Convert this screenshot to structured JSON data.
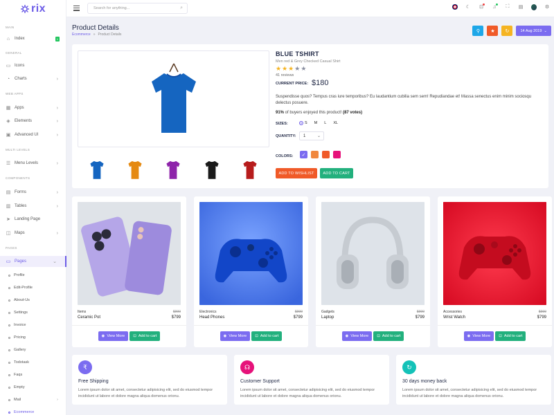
{
  "brand": {
    "name": "rix"
  },
  "sidebar": {
    "sections": [
      "Main",
      "General",
      "Web Apps",
      "Multi Levels",
      "Components",
      "Pages"
    ],
    "items": [
      {
        "label": "Index",
        "badge": "1"
      },
      {
        "label": "Icons"
      },
      {
        "label": "Charts"
      },
      {
        "label": "Apps"
      },
      {
        "label": "Elements"
      },
      {
        "label": "Advanced UI"
      },
      {
        "label": "Menu Levels"
      },
      {
        "label": "Forms"
      },
      {
        "label": "Tables"
      },
      {
        "label": "Landing Page"
      },
      {
        "label": "Maps"
      },
      {
        "label": "Pages"
      }
    ],
    "sub_items": [
      "Profile",
      "Edit-Profile",
      "About-Us",
      "Settings",
      "Invoice",
      "Pricing",
      "Gallery",
      "Todotask",
      "Faqs",
      "Empty",
      "Mail",
      "Ecommerce"
    ]
  },
  "topbar": {
    "search_placeholder": "Search for anything..."
  },
  "page": {
    "title": "Product Details",
    "breadcrumb": [
      "Ecommerce",
      "Product Details"
    ],
    "date": "14 Aug 2019"
  },
  "product": {
    "name": "BLUE TSHIRT",
    "subtitle": "Men red & Grey Checked Casual Shirt",
    "rating": 3,
    "rating_max": 5,
    "reviews": "41 reviews",
    "price_label": "CURRENT PRICE:",
    "price": "$180",
    "description": "Suspendisse quos? Tempus cras iure temporibus? Eu laudantium cubilia sem sem! Repudiandae et! Massa senectus enim minim sociosqu delectus posuere.",
    "enjoyed_pct": "91%",
    "enjoyed_text": " of buyers enjoyed this product! ",
    "enjoyed_votes": "(87 votes)",
    "sizes_label": "SIZES:",
    "sizes": [
      "S",
      "M",
      "L",
      "XL"
    ],
    "quantity_label": "QUANTITY:",
    "quantity": "1",
    "colors_label": "COLORS:",
    "colors": [
      "#7b6cf0",
      "#f0883e",
      "#f05a28",
      "#e6127a"
    ],
    "wishlist_label": "ADD TO WISHLIST",
    "cart_label": "ADD TO CART",
    "thumb_colors": [
      "#1565c0",
      "#e58a12",
      "#8e24aa",
      "#1a1a1a",
      "#b71c1c"
    ],
    "main_color": "#1565c0"
  },
  "products": [
    {
      "category": "Items",
      "name": "Ceramic Pot",
      "old_price": "$999",
      "price": "$799",
      "view": "View More",
      "cart": "Add to cart"
    },
    {
      "category": "Electronics",
      "name": "Head Phones",
      "old_price": "$999",
      "price": "$799",
      "view": "View More",
      "cart": "Add to cart"
    },
    {
      "category": "Gadgets",
      "name": "Laptop",
      "old_price": "$999",
      "price": "$799",
      "view": "View More",
      "cart": "Add to cart"
    },
    {
      "category": "Accessories",
      "name": "Wrist Watch",
      "old_price": "$999",
      "price": "$799",
      "view": "View More",
      "cart": "Add to cart"
    }
  ],
  "features": [
    {
      "title": "Free Shipping",
      "text": "Lorem ipsum dolor sit amet, consectetur adipisicing elit, sed do eiusmod tempor incididunt ut labore et dolore magna aliqua domenus orionu.",
      "color": "#7b6cf0",
      "icon": "currency-icon"
    },
    {
      "title": "Customer Support",
      "text": "Lorem ipsum dolor sit amet, consectetur adipisicing elit, sed do eiusmod tempor incididunt ut labore et dolore magna aliqua domenus orionu.",
      "color": "#e6127a",
      "icon": "headset-icon"
    },
    {
      "title": "30 days money back",
      "text": "Lorem ipsum dolor sit amet, consectetur adipisicing elit, sed do eiusmod tempor incididunt ut labore et dolore magna aliqua domenus orionu.",
      "color": "#14c2b8",
      "icon": "refresh-icon"
    }
  ],
  "colors": {
    "accent": "#6c5ce7",
    "danger": "#f05a28",
    "success": "#22b07d",
    "info": "#1ea7e8",
    "warning": "#f5b422",
    "star": "#f5b422"
  }
}
